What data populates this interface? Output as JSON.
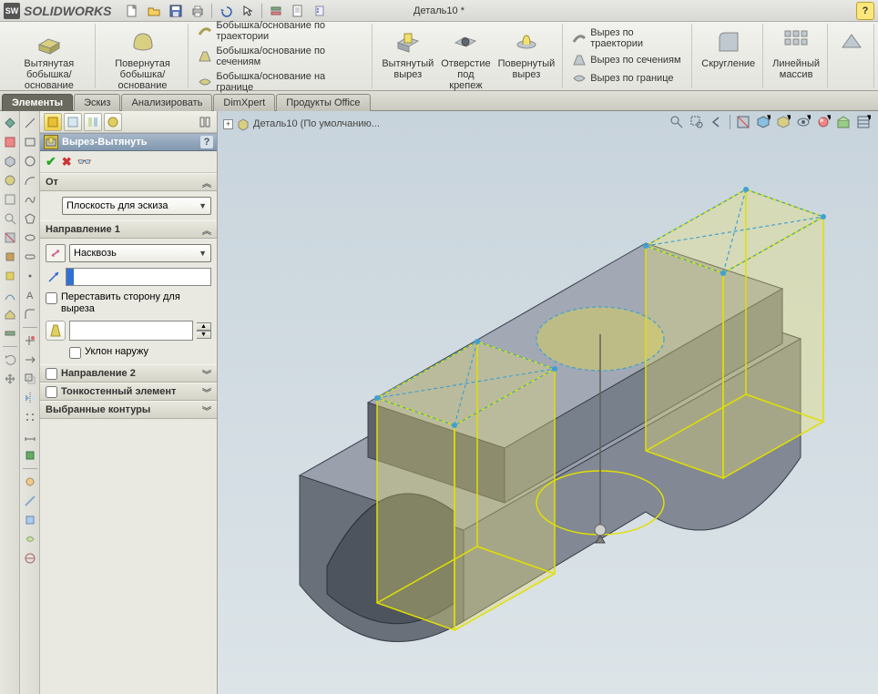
{
  "app": {
    "logo_text": "SW",
    "name": "SOLIDWORKS",
    "doc_title": "Деталь10 *",
    "help": "?"
  },
  "qat": {
    "new": "new",
    "open": "open",
    "save": "save",
    "print": "print",
    "undo": "undo",
    "redo": "redo",
    "select": "select",
    "rebuild": "rebuild",
    "options": "options",
    "sketch": "sketch"
  },
  "ribbon": {
    "extrude_boss": "Вытянутая\nбобышка/основание",
    "revolve_boss": "Повернутая\nбобышка/основание",
    "sweep_boss": "Бобышка/основание по траектории",
    "loft_boss": "Бобышка/основание по сечениям",
    "boundary_boss": "Бобышка/основание на границе",
    "extrude_cut": "Вытянутый\nвырез",
    "hole_wizard": "Отверстие\nпод\nкрепеж",
    "revolve_cut": "Повернутый\nвырез",
    "sweep_cut": "Вырез по траектории",
    "loft_cut": "Вырез по сечениям",
    "boundary_cut": "Вырез по границе",
    "fillet": "Скругление",
    "linear_pattern": "Линейный\nмассив"
  },
  "tabs": [
    "Элементы",
    "Эскиз",
    "Анализировать",
    "DimXpert",
    "Продукты Office"
  ],
  "tree": {
    "root": "Деталь10  (По умолчанию..."
  },
  "prop": {
    "title": "Вырез-Вытянуть",
    "help": "?",
    "ok": "✓",
    "cancel": "✕",
    "detail": "␣",
    "from_hdr": "От",
    "from_value": "Плоскость для эскиза",
    "dir1_hdr": "Направление 1",
    "dir1_type": "Насквозь",
    "depth_value": "",
    "flip_side": "Переставить сторону для выреза",
    "draft_out": "Уклон наружу",
    "dir2_hdr": "Направление 2",
    "thin_hdr": "Тонкостенный элемент",
    "contours_hdr": "Выбранные контуры"
  },
  "colors": {
    "accent": "#3070d0",
    "sketch_yellow": "#e0e000",
    "sel_cyan": "#40c0f0",
    "solid_face": "#8a909a",
    "solid_face_light": "#a8aeb8",
    "solid_face_dark": "#5e6470"
  }
}
